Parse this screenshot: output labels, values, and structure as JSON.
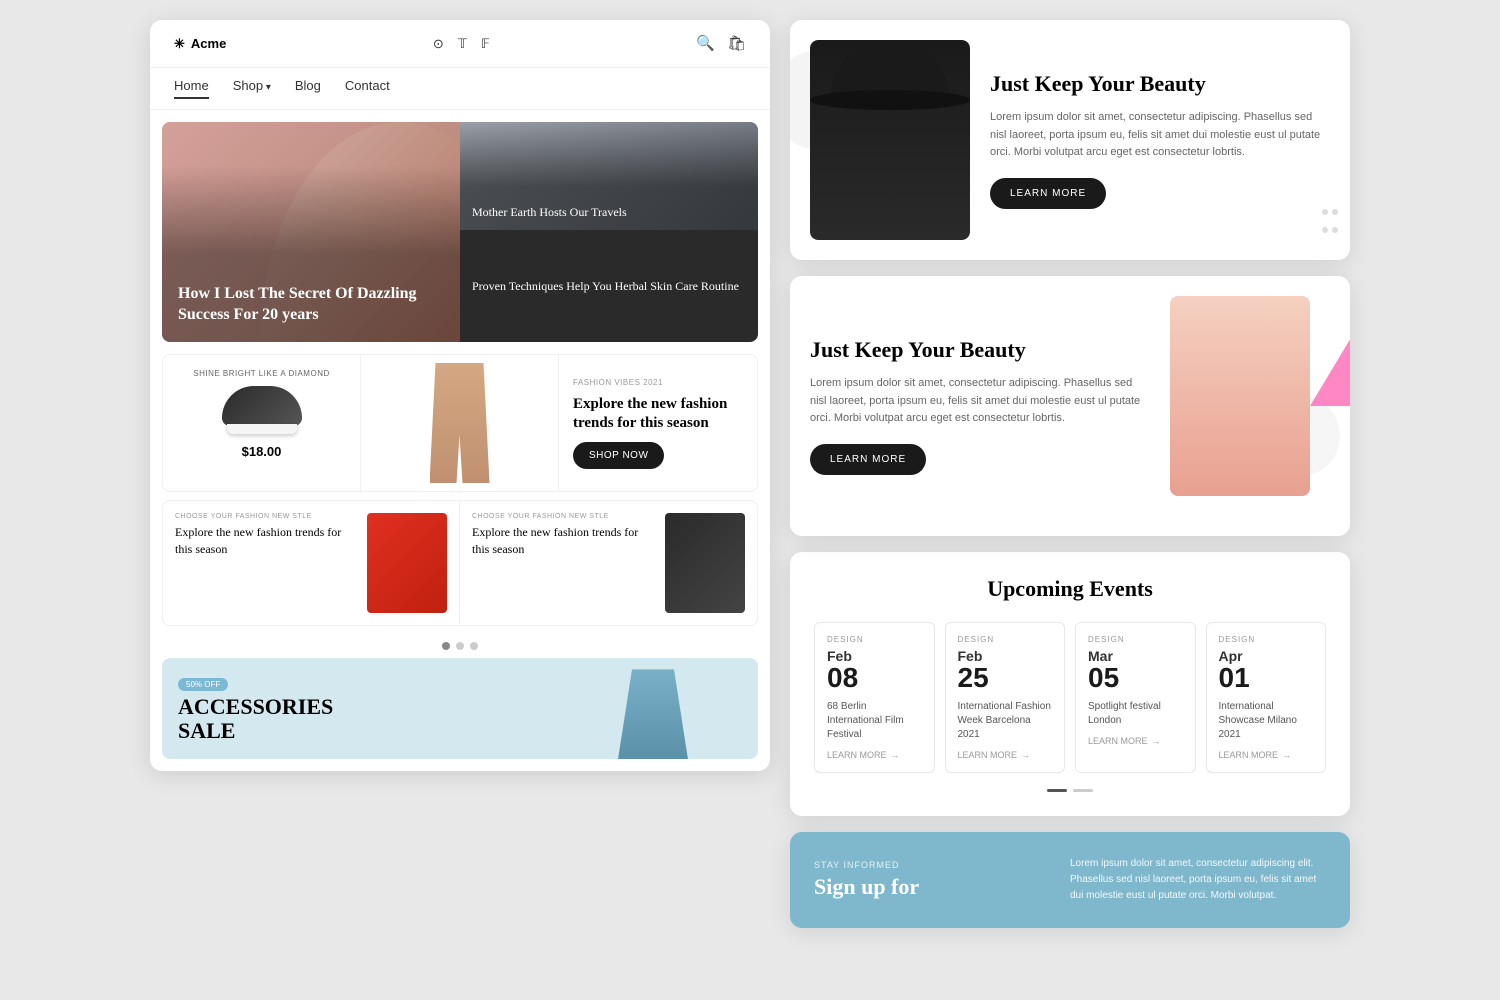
{
  "left": {
    "header": {
      "logo": "Acme",
      "asterisk": "✳",
      "social": [
        "instagram-icon",
        "twitter-icon",
        "facebook-icon"
      ],
      "icons": [
        "search-icon",
        "cart-icon"
      ]
    },
    "nav": {
      "items": [
        {
          "label": "Home",
          "active": true
        },
        {
          "label": "Shop",
          "hasArrow": true
        },
        {
          "label": "Blog"
        },
        {
          "label": "Contact"
        }
      ]
    },
    "hero": {
      "main_title": "How I Lost The Secret Of Dazzling Success For 20 years",
      "top_right": "Mother Earth Hosts Our Travels",
      "bottom_right": "Proven Techniques Help You Herbal Skin Care Routine"
    },
    "products": {
      "label": "SHINE BRIGHT LIKE A DIAMOND",
      "price": "$18.00",
      "promo_label": "FASHION VIBES 2021",
      "promo_title": "Explore the new fashion trends for this season",
      "shop_now": "SHOP NOW"
    },
    "fashion_cards": {
      "card1_label": "CHOOSE YOUR FASHION NEW STLE",
      "card1_text": "Explore the new fashion trends for this season",
      "card2_label": "CHOOSE YOUR FASHION NEW STLE",
      "card2_text": "Explore the new fashion trends for this season"
    },
    "accessories": {
      "badge": "50% OFF",
      "title": "ACCESSORIES",
      "subtitle": "SALE"
    }
  },
  "right": {
    "beauty_top": {
      "title": "Just Keep Your Beauty",
      "description": "Lorem ipsum dolor sit amet, consectetur adipiscing. Phasellus sed nisl laoreet, porta ipsum eu, felis sit amet dui molestie eust ul putate orci. Morbi volutpat arcu eget est consectetur lobrtis.",
      "button": "LEARN MORE"
    },
    "beauty_bottom": {
      "title": "Just Keep Your Beauty",
      "description": "Lorem ipsum dolor sit amet, consectetur adipiscing. Phasellus sed nisl laoreet, porta ipsum eu, felis sit amet dui molestie eust ul putate orci. Morbi volutpat arcu eget est consectetur lobrtis.",
      "button": "LEARN MORE"
    },
    "events": {
      "title": "Upcoming Events",
      "items": [
        {
          "category": "DESIGN",
          "month": "Feb",
          "day": "08",
          "name": "68 Berlin International Film Festival",
          "learn_more": "LEARN MORE"
        },
        {
          "category": "DESIGN",
          "month": "Feb",
          "day": "25",
          "name": "International Fashion Week Barcelona 2021",
          "learn_more": "LEARN MORE"
        },
        {
          "category": "DESIGN",
          "month": "Mar",
          "day": "05",
          "name": "Spotlight festival London",
          "learn_more": "LEARN MORE"
        },
        {
          "category": "DESIGN",
          "month": "Apr",
          "day": "01",
          "name": "International Showcase Milano 2021",
          "learn_more": "LEARN MORE"
        }
      ]
    },
    "newsletter": {
      "label": "STAY INFORMED",
      "title": "Sign up for",
      "description": "Lorem ipsum dolor sit amet, consectetur adipiscing elit. Phasellus sed nisl laoreet, porta ipsum eu, felis sit amet dui molestie eust ul putate orci. Morbi volutpat."
    }
  }
}
